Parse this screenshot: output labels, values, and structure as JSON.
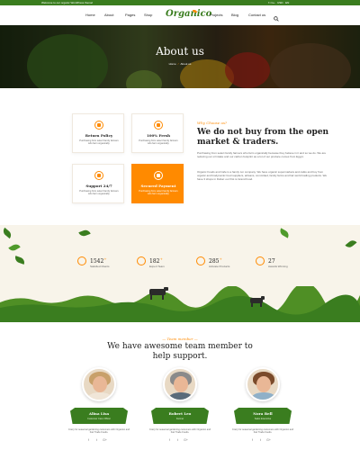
{
  "topbar": {
    "welcome": "Welcome to our organic WordPress theme!",
    "right": "f  t  G+  ·  USD  ·  EN"
  },
  "nav": {
    "logo": "Organico",
    "items": [
      "Home",
      "About",
      "Pages",
      "Shop",
      "Projects",
      "Blog",
      "Contact us"
    ]
  },
  "hero": {
    "title": "About us",
    "breadcrumb_home": "Home",
    "breadcrumb_sep": "/",
    "breadcrumb_current": "About us"
  },
  "features": {
    "cards": [
      {
        "title": "Return Policy",
        "text": "Purchasing from select family farmers who farm organically.",
        "active": false
      },
      {
        "title": "100% Fresh",
        "text": "Purchasing from select family farmers who farm organically.",
        "active": false
      },
      {
        "title": "Support 24/7",
        "text": "Purchasing from select family farmers who farm organically.",
        "active": false
      },
      {
        "title": "Secured Payment",
        "text": "Purchasing from select family farmers who farm organically.",
        "active": true
      }
    ],
    "kicker": "Why Choose us?",
    "heading": "We do not buy from the open market & traders.",
    "para1": "Purchasing from select family farmers who farm organically because they believe in it and so we do. We are reducing our oil intake and our carbon footprint as a lot of our produce comes from Egypt.",
    "para2": "Organic Foods and Cafe is a family run company. We have organic supermarkets and cafés and buy from organic and biodynamic food suppliers, artisans, committed, family farms and fair world trading products. We have 3 shops in Dubai: our first is Grand Food."
  },
  "stats": [
    {
      "icon": "people-icon",
      "value": "1542",
      "suffix": "+",
      "label": "Satisfied Clients"
    },
    {
      "icon": "leaf-icon",
      "value": "182",
      "suffix": "+",
      "label": "Expert Team"
    },
    {
      "icon": "basket-icon",
      "value": "285",
      "suffix": "+",
      "label": "Activate Products"
    },
    {
      "icon": "trophy-icon",
      "value": "27",
      "suffix": "",
      "label": "Awards Winning"
    }
  ],
  "team": {
    "kicker": "— Team member —",
    "heading": "We have awesome team member to help support.",
    "members": [
      {
        "name": "Alina Lisa",
        "role": "Customer Care Officer",
        "desc": "Crazy for seasonal gardening customers with Organico and Fair Trade Foods."
      },
      {
        "name": "Robert Leo",
        "role": "Farmer",
        "desc": "Crazy for seasonal gardening customers with Organico and Fair Trade Foods."
      },
      {
        "name": "Nora Bell",
        "role": "Sales Executive",
        "desc": "Crazy for seasonal gardening customers with Organico and Fair Trade Foods."
      }
    ],
    "social_icons": [
      "f",
      "t",
      "G+"
    ]
  },
  "colors": {
    "primary_green": "#3a7d1f",
    "accent_orange": "#ff8a00"
  }
}
